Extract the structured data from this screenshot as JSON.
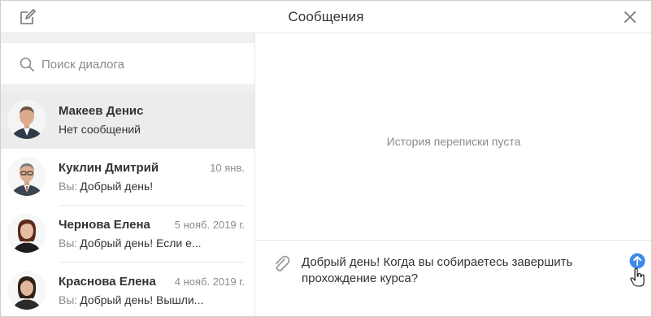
{
  "header": {
    "title": "Сообщения",
    "icons": {
      "compose": "edit-icon",
      "close": "close-icon"
    }
  },
  "search": {
    "placeholder": "Поиск диалога",
    "icon": "search-icon"
  },
  "dialogs": [
    {
      "name": "Макеев Денис",
      "date": "",
      "you_prefix": "",
      "preview": "Нет сообщений",
      "active": true
    },
    {
      "name": "Куклин Дмитрий",
      "date": "10 янв.",
      "you_prefix": "Вы:",
      "preview": "Добрый день!",
      "active": false
    },
    {
      "name": "Чернова Елена",
      "date": "5 нояб. 2019 г.",
      "you_prefix": "Вы:",
      "preview": "Добрый день! Если е...",
      "active": false
    },
    {
      "name": "Краснова Елена",
      "date": "4 нояб. 2019 г.",
      "you_prefix": "Вы:",
      "preview": "Добрый день! Вышли...",
      "active": false
    }
  ],
  "conversation": {
    "empty_text": "История переписки пуста"
  },
  "composer": {
    "message": "Добрый день! Когда вы собираетесь завершить прохождение курса?",
    "icons": {
      "attach": "paperclip-icon",
      "send": "send-arrow-icon"
    }
  },
  "colors": {
    "accent": "#3d8be8",
    "active_row": "#ececec",
    "muted_text": "#8c8c8c",
    "panel_strip": "#f0f0f0"
  }
}
